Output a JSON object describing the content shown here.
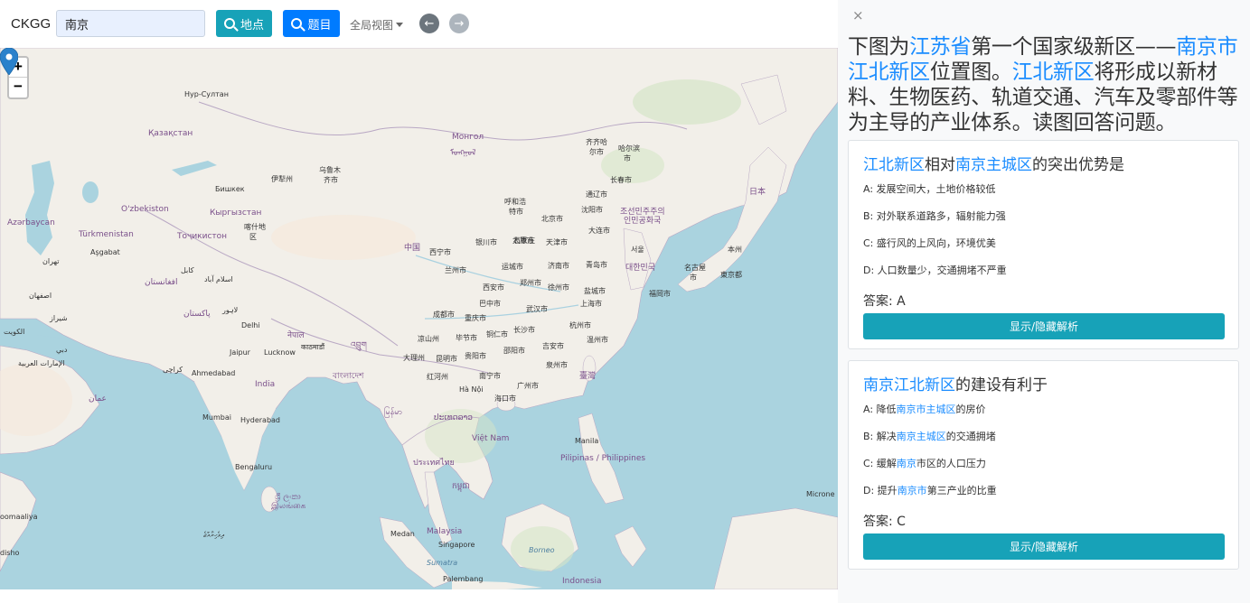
{
  "header": {
    "brand": "CKGG",
    "search_value": "南京",
    "place_button": "地点",
    "topic_button": "题目",
    "view_label": "全局视图"
  },
  "map": {
    "zoom_in": "+",
    "zoom_out": "−",
    "labels": {
      "kazakhstan": "Қазақстан",
      "nursultan": "Нур-Султан",
      "mongolia1": "Монгол",
      "mongolia2": "ᠮᠣᠩᠭᠣᠯ",
      "urumqi1": "乌鲁木",
      "urumqi2": "齐市",
      "bishkek": "Бишкек",
      "yining": "伊犁州",
      "uzbekistan": "O'zbekiston",
      "kyrgyzstan": "Кыргызстан",
      "azerbaijan": "Azərbaycan",
      "turkmenistan": "Türkmenistan",
      "tajikistan": "Тоҷикистон",
      "kashgar1": "喀什地",
      "kashgar2": "区",
      "ashgabat": "Aşgabat",
      "tehran": "تهران",
      "kabul": "کابل",
      "islamabad": "اسلام آباد",
      "afghanistan": "افغانستان",
      "isfahan": "اصفهان",
      "pakistan": "پاکستان",
      "lahore": "لاہور",
      "delhi": "Delhi",
      "kuwait": "الكويت",
      "shiraz": "شيراز",
      "nepal": "नेपाल",
      "kathmandu": "काठमाडौं",
      "jaipur": "Jaipur",
      "lucknow": "Lucknow",
      "bhutan": "འབྲུག",
      "uae": "الإمارات العربية",
      "karachi": "کراچی",
      "ahmedabad": "Ahmedabad",
      "india": "India",
      "bangladesh": "বাংলাদেশ",
      "oman": "عمان",
      "mumbai": "Mumbai",
      "hyderabad": "Hyderabad",
      "myanmar": "မြန်မာ",
      "bengaluru": "Bengaluru",
      "srilanka1": "ශ්‍රී ලංකා",
      "srilanka2": "இலங்கை",
      "china": "中国",
      "xining": "西宁市",
      "lanzhou": "兰州市",
      "yinchuan": "银川市",
      "taiyuan": "太原市",
      "shijiazhuang": "石家庄",
      "shijiazhuang2": "市",
      "beijing": "北京市",
      "tianjin": "天津市",
      "hohhot1": "呼和浩",
      "hohhot2": "特市",
      "jinan": "济南市",
      "qingdao": "青岛市",
      "yuncheng": "运城市",
      "zhengzhou": "郑州市",
      "xian": "西安市",
      "xuzhou": "徐州市",
      "yancheng": "盐城市",
      "shanghai": "上海市",
      "hangzhou": "杭州市",
      "wuhan": "武汉市",
      "bazhong": "巴中市",
      "chengdu": "成都市",
      "chongqing": "重庆市",
      "changsha": "长沙市",
      "tongren": "铜仁市",
      "bijie": "毕节市",
      "liangshan": "凉山州",
      "guiyang": "贵阳市",
      "shaoyang": "邵阳市",
      "jian": "吉安市",
      "wenzhou": "温州市",
      "quanzhou": "泉州市",
      "kunming": "昆明市",
      "dali": "大理州",
      "nanning": "南宁市",
      "guangzhou": "广州市",
      "honghe": "红河州",
      "taiwan": "臺灣",
      "haikou": "海口市",
      "hanoi": "Hà Nội",
      "laos": "ປະເທດລາວ",
      "thailand": "ประเทศไทย",
      "vietnam": "Việt Nam",
      "cambodia": "កម្ពុជា",
      "manila": "Manila",
      "philippines": "Pilipinas / Philippines",
      "malaysia": "Malaysia",
      "singapore": "Singapore",
      "medan": "Medan",
      "borneo": "Borneo",
      "sumatra": "Sumatra",
      "palembang": "Palembang",
      "indonesia": "Indonesia",
      "harbin1": "哈尔滨",
      "harbin2": "市",
      "qiqihar1": "齐齐哈",
      "qiqihar2": "尔市",
      "changchun": "长春市",
      "tongliao": "通辽市",
      "shenyang": "沈阳市",
      "nk1": "조선민주주의",
      "nk2": "인민공화국",
      "dalian": "大连市",
      "korea": "대한민국",
      "seoul": "서울",
      "japan": "日本",
      "honshu": "本州",
      "nagoya": "名古屋",
      "nagoya2": "市",
      "tokyo": "東京都",
      "fukuoka": "福岡市",
      "micronesia": "Microne",
      "maldives": "ދިވެހިރާއްޖެ",
      "somalia": "oomaaliya",
      "sho": "disho",
      "dubai": "دبي"
    }
  },
  "panel": {
    "close_symbol": "×",
    "intro": {
      "p1": "下图为",
      "h1": "江苏省",
      "p2": "第一个国家级新区——",
      "h2": "南京市江北新区",
      "p3": "位置图。",
      "h3": "江北新区",
      "p4": "将形成以新材料、生物医药、轨道交通、汽车及零部件等为主导的产业体系。读图回答问题。"
    },
    "q1": {
      "title_h1": "江北新区",
      "title_p1": "相对",
      "title_h2": "南京主城区",
      "title_p2": "的突出优势是",
      "options": [
        "A: 发展空间大，土地价格较低",
        "B: 对外联系道路多，辐射能力强",
        "C: 盛行风的上风向，环境优美",
        "D: 人口数量少，交通拥堵不严重"
      ],
      "answer": "答案: A",
      "toggle": "显示/隐藏解析"
    },
    "q2": {
      "title_h1": "南京江北新区",
      "title_p1": "的建设有利于",
      "optA_p1": "A: 降低",
      "optA_h": "南京市主城区",
      "optA_p2": "的房价",
      "optB_p1": "B: 解决",
      "optB_h": "南京主城区",
      "optB_p2": "的交通拥堵",
      "optC_p1": "C: 缓解",
      "optC_h": "南京",
      "optC_p2": "市区的人口压力",
      "optD_p1": "D: 提升",
      "optD_h": "南京市",
      "optD_p2": "第三产业的比重",
      "answer": "答案: C",
      "toggle": "显示/隐藏解析"
    }
  }
}
